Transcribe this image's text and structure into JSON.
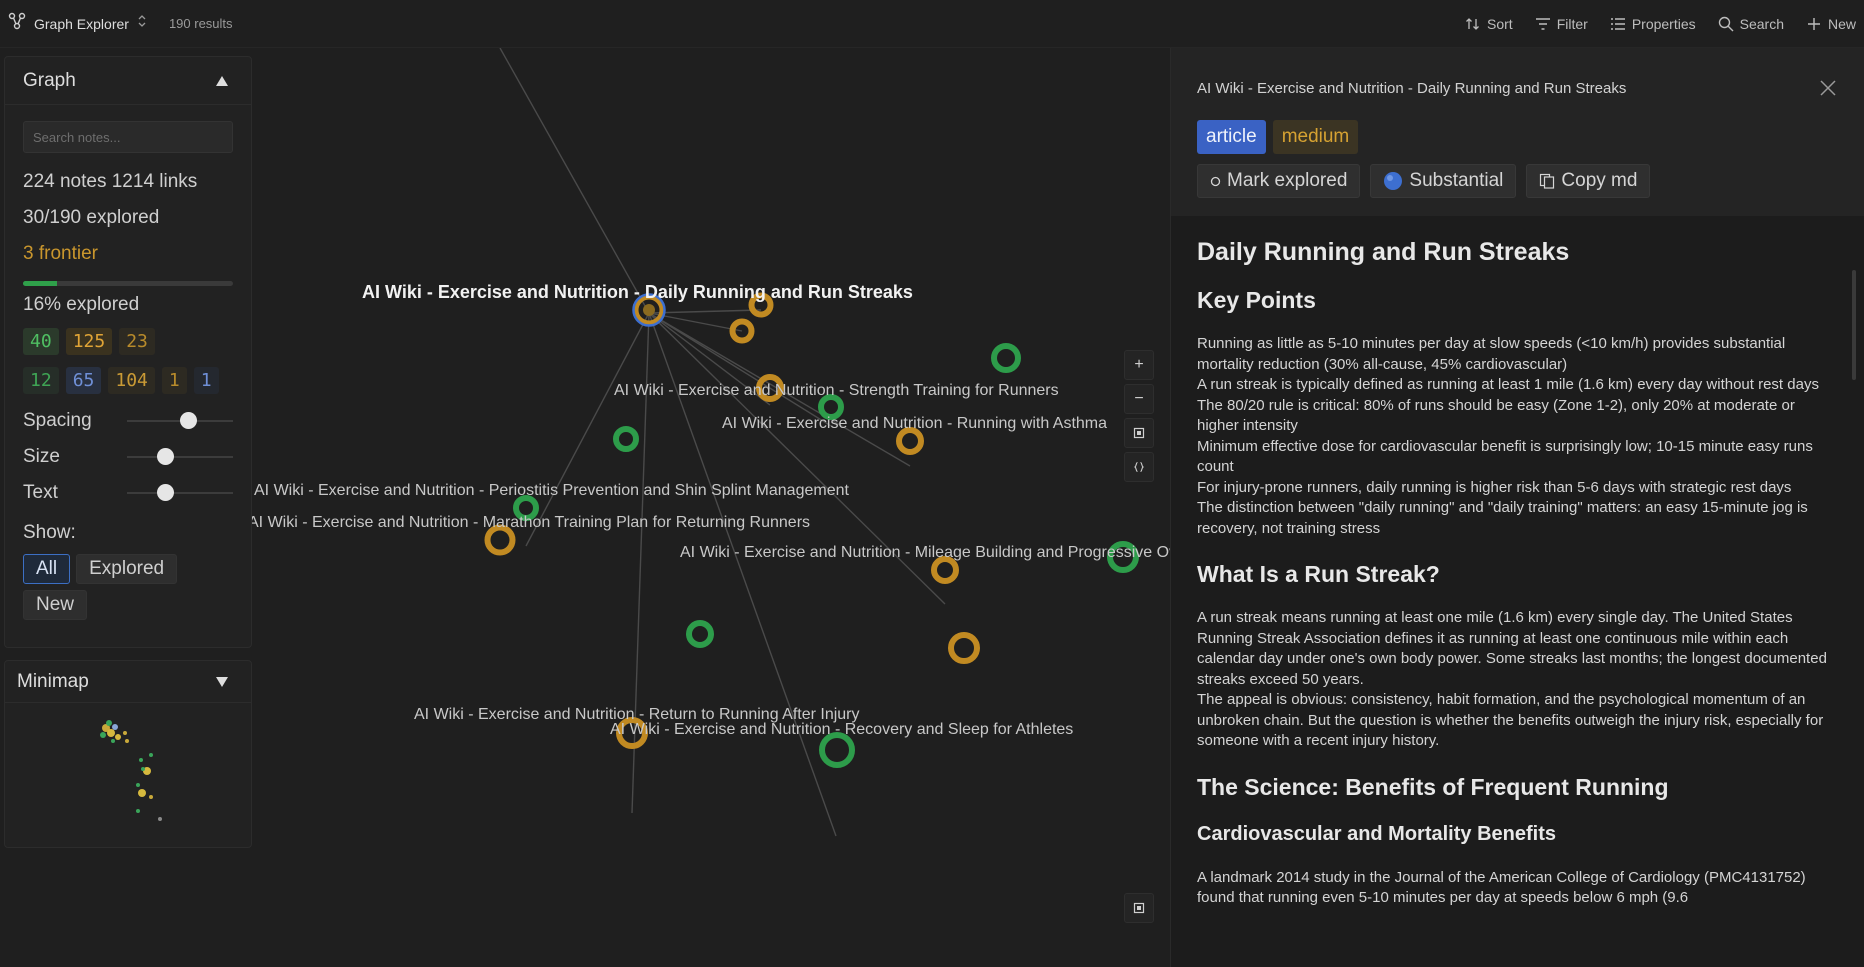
{
  "topbar": {
    "app_title": "Graph Explorer",
    "result_count": "190 results",
    "actions": {
      "sort": "Sort",
      "filter": "Filter",
      "properties": "Properties",
      "search": "Search",
      "new": "New"
    }
  },
  "graph_panel": {
    "title": "Graph",
    "search_placeholder": "Search notes...",
    "notes_links": "224 notes  1214 links",
    "explored": "30/190 explored",
    "frontier": "3 frontier",
    "progress_fraction": 0.16,
    "explored_percent": "16% explored",
    "badges_row1": [
      "40",
      "125",
      "23"
    ],
    "badges_row2": [
      "12",
      "65",
      "104",
      "1",
      "1"
    ],
    "sliders": {
      "spacing": {
        "label": "Spacing",
        "value": 0.58
      },
      "size": {
        "label": "Size",
        "value": 0.36
      },
      "text": {
        "label": "Text",
        "value": 0.36
      }
    },
    "show_label": "Show:",
    "show_options": [
      "All",
      "Explored",
      "New"
    ],
    "show_selected": "All"
  },
  "minimap": {
    "title": "Minimap"
  },
  "graph": {
    "labels": {
      "center": "AI Wiki - Exercise and Nutrition - Daily Running and Run Streaks",
      "strength": "AI Wiki - Exercise and Nutrition - Strength Training for Runners",
      "asthma": "AI Wiki - Exercise and Nutrition - Running with Asthma",
      "periostitis": "AI Wiki - Exercise and Nutrition - Periostitis Prevention and Shin Splint Management",
      "marathon": "AI Wiki - Exercise and Nutrition - Marathon Training Plan for Returning Runners",
      "mileage": "AI Wiki - Exercise and Nutrition - Mileage Building and Progressive Ove",
      "return": "AI Wiki - Exercise and Nutrition - Return to Running After Injury",
      "recovery": "AI Wiki - Exercise and Nutrition - Recovery and Sleep for Athletes"
    },
    "zoom_in": "+",
    "zoom_out": "−",
    "colors": {
      "green": "#2d9c4a",
      "orange": "#c18a22",
      "blue": "#3d6fd0"
    }
  },
  "detail": {
    "header_title": "AI Wiki - Exercise and Nutrition - Daily Running and Run Streaks",
    "tags": [
      "article",
      "medium"
    ],
    "mark_explored": "Mark explored",
    "substantial": "Substantial",
    "copy_md": "Copy md",
    "title": "Daily Running and Run Streaks",
    "key_points_heading": "Key Points",
    "key_points": [
      "Running as little as 5-10 minutes per day at slow speeds (<10 km/h) provides substantial mortality reduction (30% all-cause, 45% cardiovascular)",
      "A run streak is typically defined as running at least 1 mile (1.6 km) every day without rest days",
      "The 80/20 rule is critical: 80% of runs should be easy (Zone 1-2), only 20% at moderate or higher intensity",
      "Minimum effective dose for cardiovascular benefit is surprisingly low; 10-15 minute easy runs count",
      "For injury-prone runners, daily running is higher risk than 5-6 days with strategic rest days",
      "The distinction between \"daily running\" and \"daily training\" matters: an easy 15-minute jog is recovery, not training stress"
    ],
    "streak_heading": "What Is a Run Streak?",
    "streak_paragraphs": [
      "A run streak means running at least one mile (1.6 km) every single day. The United States Running Streak Association defines it as running at least one continuous mile within each calendar day under one's own body power. Some streaks last months; the longest documented streaks exceed 50 years.",
      "The appeal is obvious: consistency, habit formation, and the psychological momentum of an unbroken chain. But the question is whether the benefits outweigh the injury risk, especially for someone with a recent injury history."
    ],
    "science_heading": "The Science: Benefits of Frequent Running",
    "cardio_heading": "Cardiovascular and Mortality Benefits",
    "cardio_paragraph": "A landmark 2014 study in the Journal of the American College of Cardiology (PMC4131752) found that running even 5-10 minutes per day at speeds below 6 mph (9.6"
  }
}
